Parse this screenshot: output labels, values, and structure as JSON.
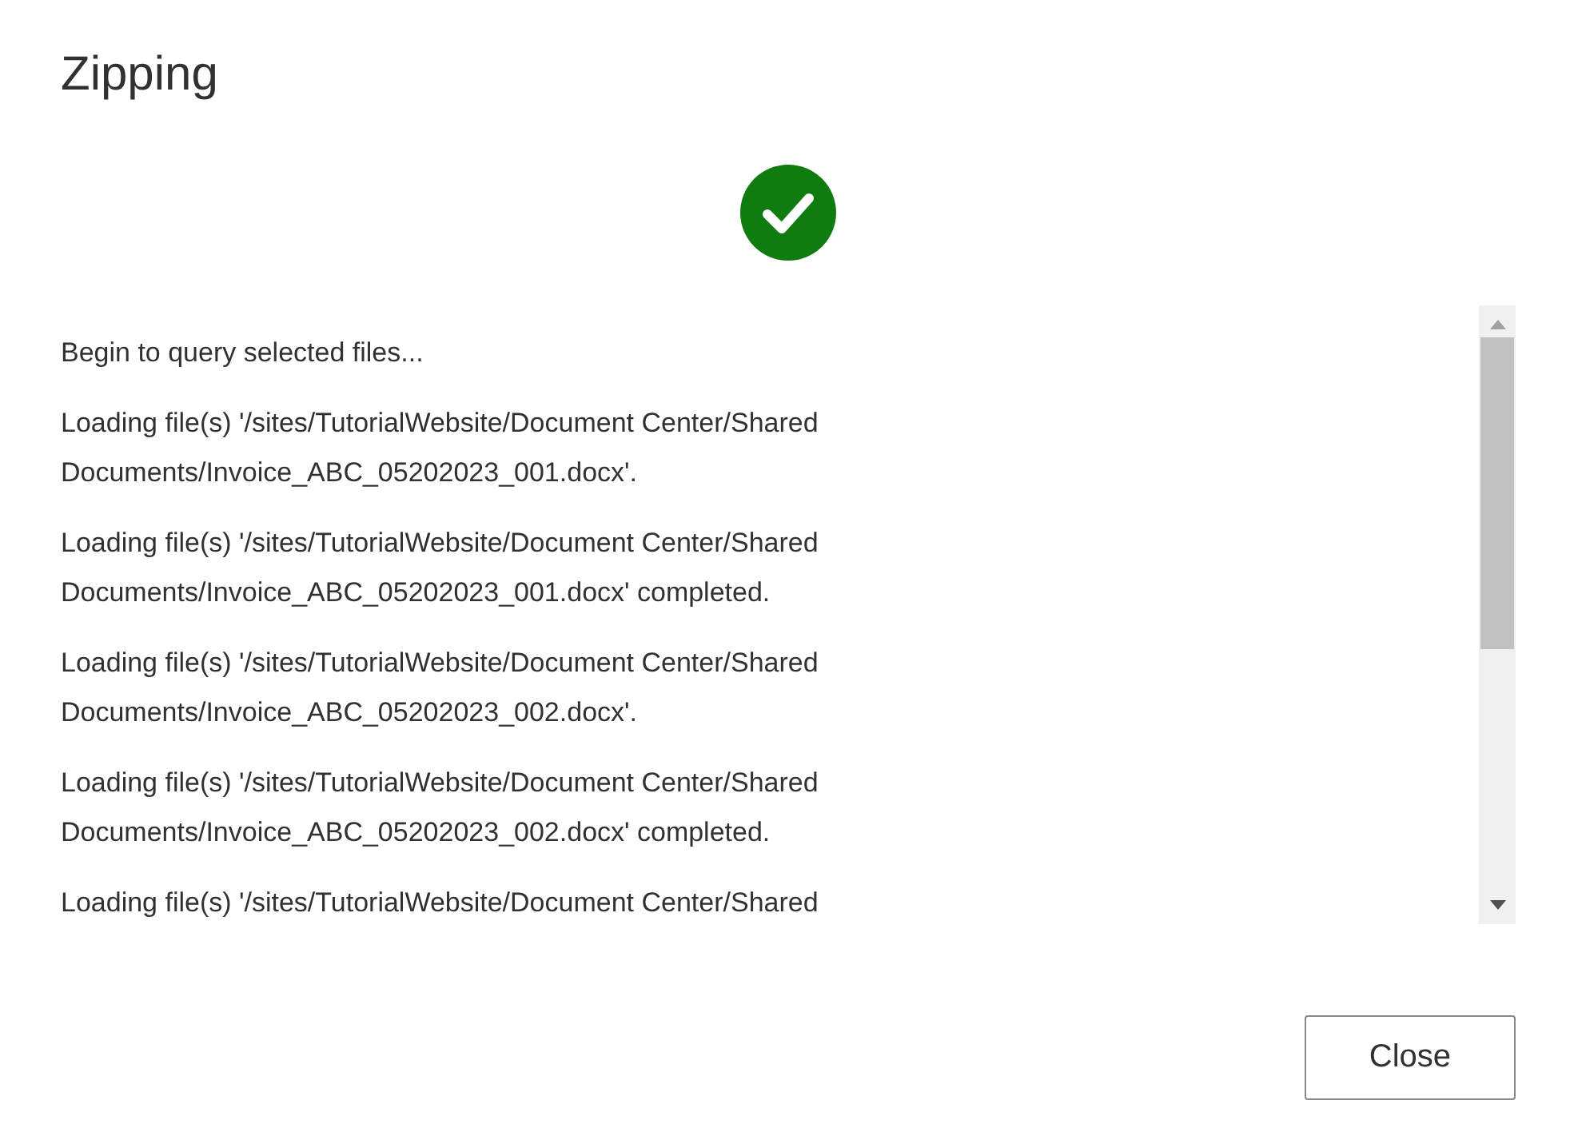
{
  "dialog": {
    "title": "Zipping",
    "completed": true
  },
  "log": [
    "Begin to query selected files...",
    "Loading file(s) '/sites/TutorialWebsite/Document Center/Shared Documents/Invoice_ABC_05202023_001.docx'.",
    "Loading file(s) '/sites/TutorialWebsite/Document Center/Shared Documents/Invoice_ABC_05202023_001.docx' completed.",
    "Loading file(s) '/sites/TutorialWebsite/Document Center/Shared Documents/Invoice_ABC_05202023_002.docx'.",
    "Loading file(s) '/sites/TutorialWebsite/Document Center/Shared Documents/Invoice_ABC_05202023_002.docx' completed.",
    "Loading file(s) '/sites/TutorialWebsite/Document Center/Shared"
  ],
  "buttons": [
    "Close"
  ]
}
